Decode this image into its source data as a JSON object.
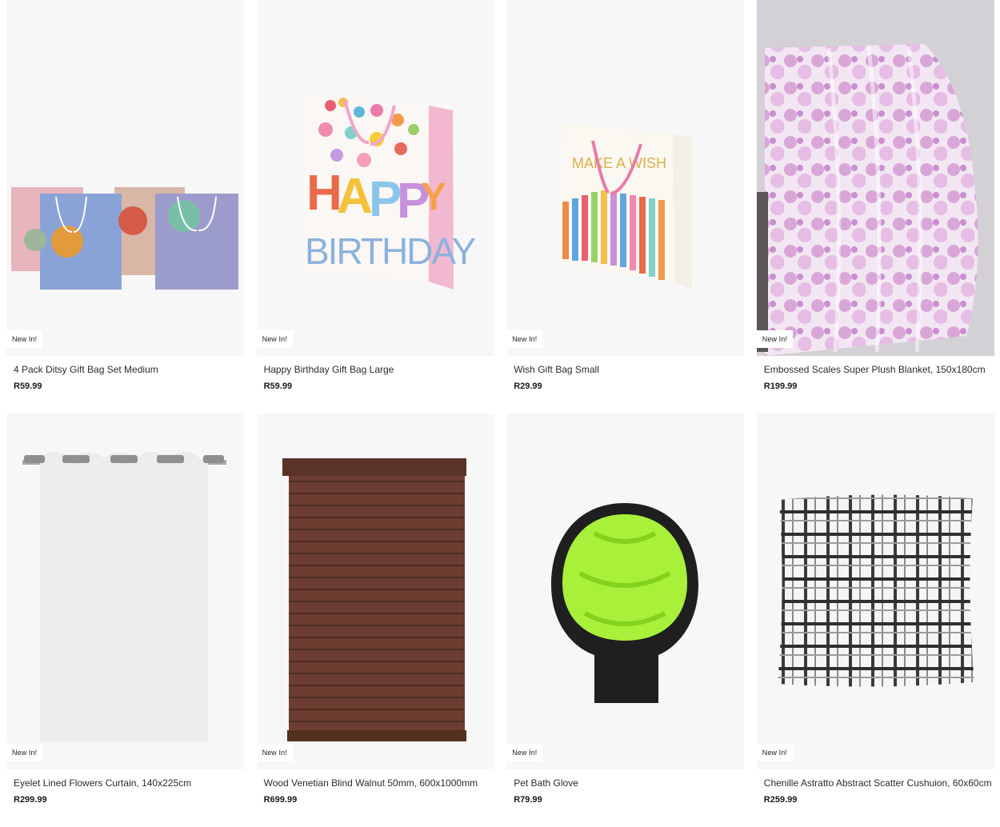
{
  "products": [
    {
      "name": "4 Pack Ditsy Gift Bag Set Medium",
      "price": "R59.99",
      "badge": "New In!",
      "image": "gift-bag-set-image"
    },
    {
      "name": "Happy Birthday Gift Bag Large",
      "price": "R59.99",
      "badge": "New In!",
      "image": "birthday-gift-bag-image",
      "image_text": "HAPPY BIRTHDAY"
    },
    {
      "name": "Wish Gift Bag Small",
      "price": "R29.99",
      "badge": "New In!",
      "image": "wish-gift-bag-image",
      "image_text": "MAKE A WISH"
    },
    {
      "name": "Embossed Scales Super Plush Blanket, 150x180cm",
      "price": "R199.99",
      "badge": "New In!",
      "image": "plush-blanket-image"
    },
    {
      "name": "Eyelet Lined Flowers Curtain, 140x225cm",
      "price": "R299.99",
      "badge": "New In!",
      "image": "curtain-image"
    },
    {
      "name": "Wood Venetian Blind Walnut 50mm, 600x1000mm",
      "price": "R699.99",
      "badge": "New In!",
      "image": "venetian-blind-image"
    },
    {
      "name": "Pet Bath Glove",
      "price": "R79.99",
      "badge": "New In!",
      "image": "pet-bath-glove-image"
    },
    {
      "name": "Chenille Astratto Abstract Scatter Cushuion, 60x60cm",
      "price": "R259.99",
      "badge": "New In!",
      "image": "scatter-cushion-image"
    }
  ],
  "colors": {
    "card_bg": "#f7f7f7",
    "badge_bg": "#ffffff"
  }
}
